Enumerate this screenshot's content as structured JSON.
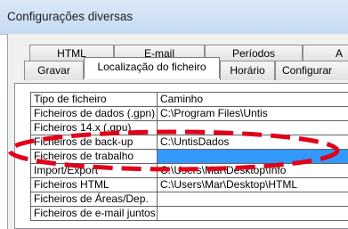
{
  "window": {
    "title": "Configurações diversas"
  },
  "tabs_back": [
    "HTML",
    "E-mail",
    "Períodos",
    "A"
  ],
  "tabs_front": [
    "Gravar",
    "Localização do ficheiro",
    "Horário",
    "Configurar"
  ],
  "table": {
    "headers": [
      "Tipo de ficheiro",
      "Caminho"
    ],
    "rows": [
      [
        "Ficheiros de dados (.gpn)",
        "C:\\Program Files\\Untis"
      ],
      [
        "Ficheiros 14.x (.gpu)",
        ""
      ],
      [
        "Ficheiros de back-up",
        "C:\\UntisDados"
      ],
      [
        "Ficheiros de trabalho",
        ""
      ],
      [
        "Import/Export",
        "C:\\Users\\Mar\\Desktop\\Info"
      ],
      [
        "Ficheiros HTML",
        "C:\\Users\\Mar\\Desktop\\HTML"
      ],
      [
        "Ficheiros de Áreas/Dep.",
        ""
      ],
      [
        "Ficheiros de e-mail juntos",
        ""
      ]
    ],
    "selected_row": 3
  },
  "colors": {
    "selection": "#3399ff",
    "annotation": "#e0001a"
  }
}
